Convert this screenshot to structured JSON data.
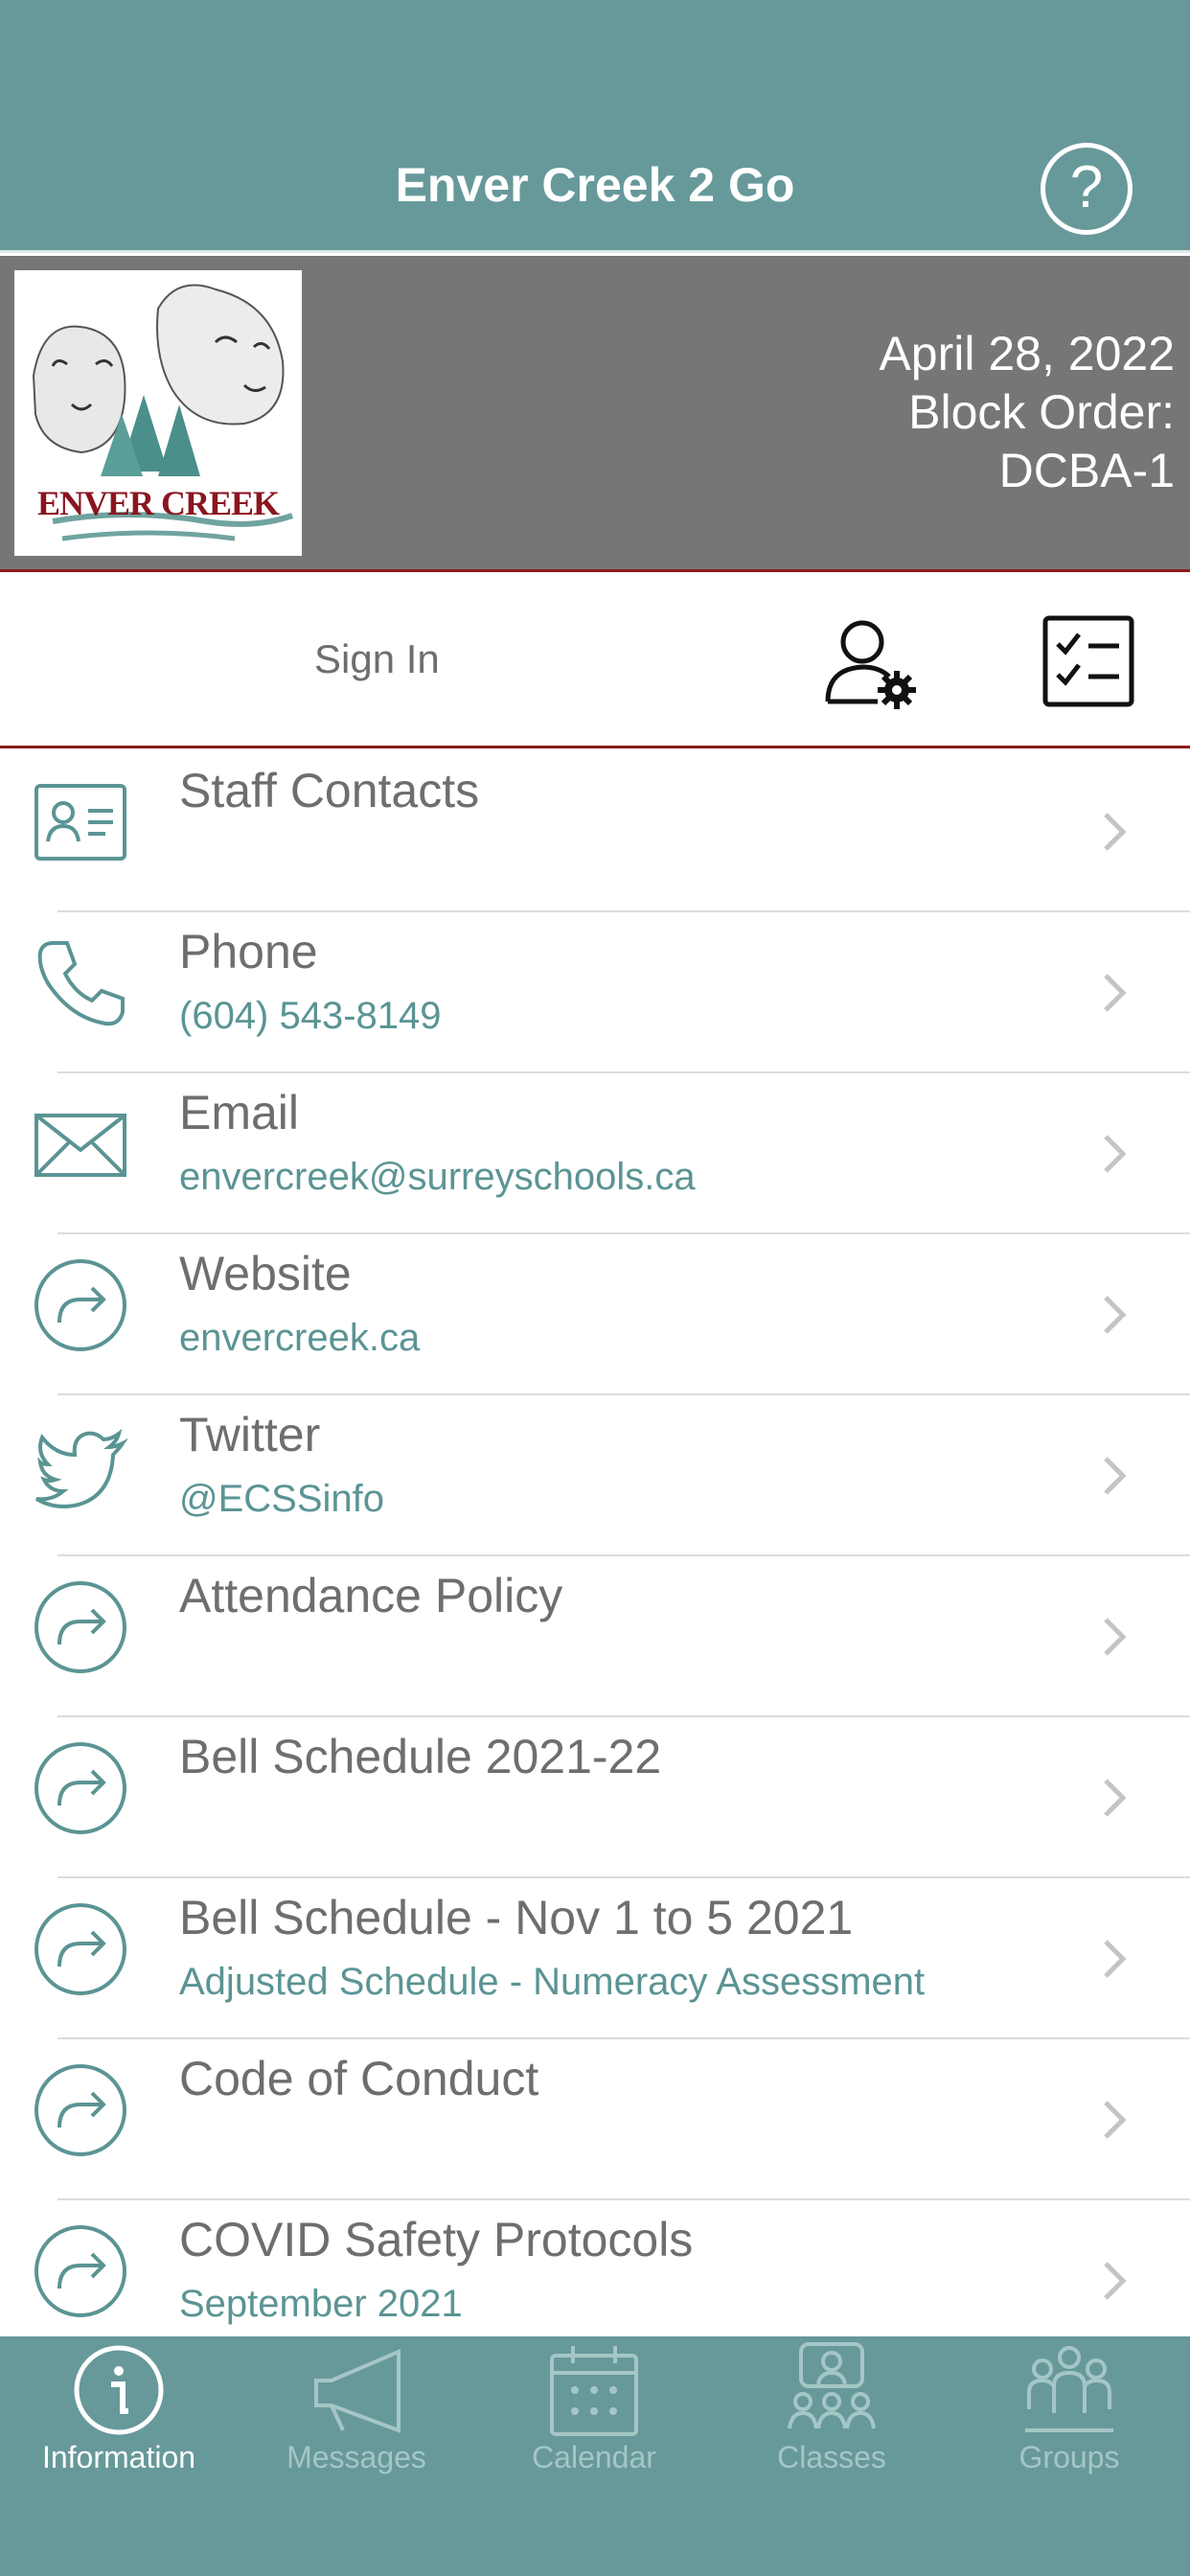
{
  "header": {
    "title": "Enver Creek 2 Go",
    "help_icon": "question-circle-icon",
    "help_glyph": "?"
  },
  "banner": {
    "logo_text": "ENVER CREEK",
    "date": "April 28, 2022",
    "block_order_label": "Block Order:",
    "block_order_value": "DCBA-1"
  },
  "account": {
    "sign_in_label": "Sign In",
    "settings_icon": "user-settings-icon",
    "checklist_icon": "checklist-icon"
  },
  "list": {
    "items": [
      {
        "label": "Staff Contacts",
        "sub": "",
        "icon": "contact-card-icon"
      },
      {
        "label": "Phone",
        "sub": "(604) 543-8149",
        "icon": "phone-icon"
      },
      {
        "label": "Email",
        "sub": "envercreek@surreyschools.ca",
        "icon": "envelope-icon"
      },
      {
        "label": "Website",
        "sub": "envercreek.ca",
        "icon": "link-arrow-icon"
      },
      {
        "label": "Twitter",
        "sub": "@ECSSinfo",
        "icon": "twitter-bird-icon"
      },
      {
        "label": "Attendance Policy",
        "sub": "",
        "icon": "link-arrow-icon"
      },
      {
        "label": "Bell Schedule 2021-22",
        "sub": "",
        "icon": "link-arrow-icon"
      },
      {
        "label": "Bell Schedule - Nov 1 to 5 2021",
        "sub": "Adjusted Schedule - Numeracy Assessment",
        "icon": "link-arrow-icon"
      },
      {
        "label": "Code of Conduct",
        "sub": "",
        "icon": "link-arrow-icon"
      },
      {
        "label": "COVID Safety Protocols",
        "sub": "September 2021",
        "icon": "link-arrow-icon"
      }
    ]
  },
  "tabs": [
    {
      "label": "Information",
      "icon": "info-circle-icon",
      "active": true
    },
    {
      "label": "Messages",
      "icon": "megaphone-icon",
      "active": false
    },
    {
      "label": "Calendar",
      "icon": "calendar-icon",
      "active": false
    },
    {
      "label": "Classes",
      "icon": "classroom-icon",
      "active": false
    },
    {
      "label": "Groups",
      "icon": "group-icon",
      "active": false
    }
  ],
  "colors": {
    "brand_teal": "#67999a",
    "banner_gray": "#767676",
    "accent_red": "#8c1b1b",
    "link_teal": "#5b9494",
    "tab_inactive": "#a5c6c6"
  }
}
